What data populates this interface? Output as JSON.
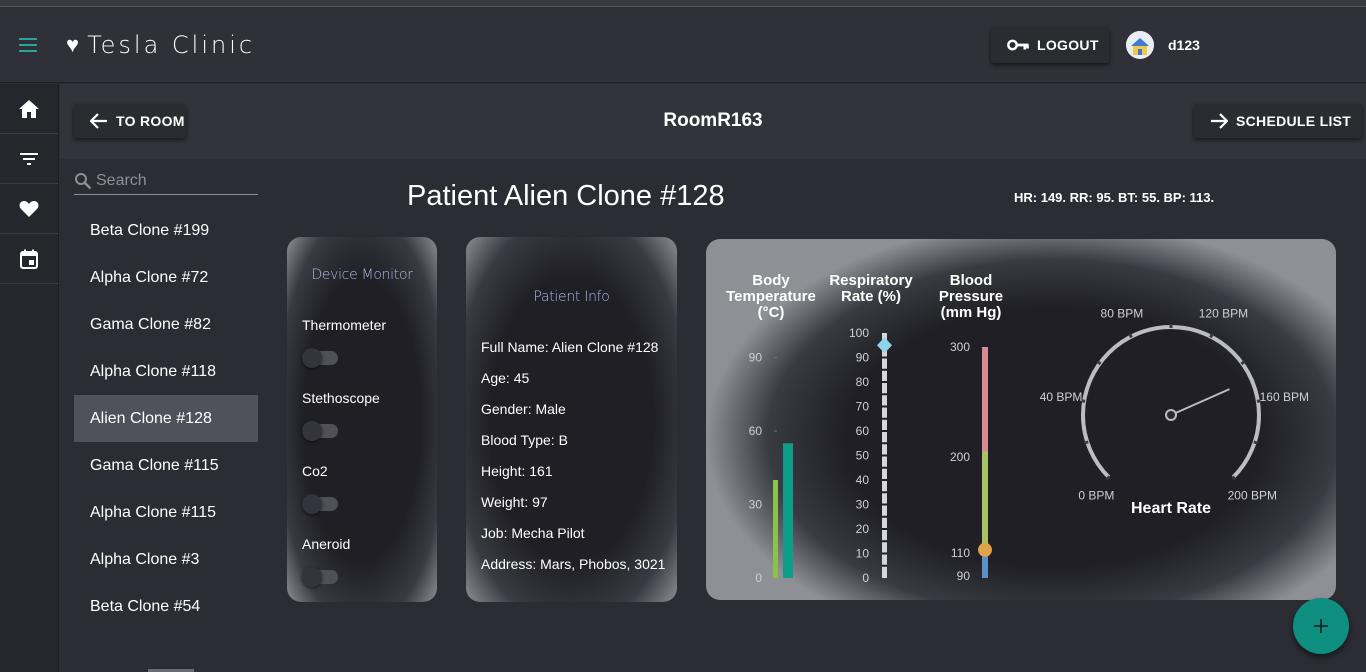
{
  "app": {
    "title": "Tesla Clinic",
    "user": "d123"
  },
  "header": {
    "logout_label": "LOGOUT"
  },
  "rail": {
    "items": [
      "home-icon",
      "filter-icon",
      "heart-icon",
      "calendar-icon"
    ]
  },
  "subbar": {
    "back_label": "TO ROOM",
    "room": "RoomR163",
    "schedule_label": "SCHEDULE LIST"
  },
  "search": {
    "placeholder": "Search",
    "value": ""
  },
  "patients": [
    "Beta Clone #199",
    "Alpha Clone #72",
    "Gama Clone #82",
    "Alpha Clone #118",
    "Alien Clone #128",
    "Gama Clone #115",
    "Alpha Clone #115",
    "Alpha Clone #3",
    "Beta Clone #54"
  ],
  "selected_patient": "Alien Clone #128",
  "patient": {
    "title": "Patient Alien Clone #128",
    "vitals_summary": "HR: 149. RR: 95. BT: 55. BP: 113."
  },
  "device_monitor": {
    "title": "Device Monitor",
    "devices": [
      {
        "label": "Thermometer",
        "on": false
      },
      {
        "label": "Stethoscope",
        "on": false
      },
      {
        "label": "Co2",
        "on": false
      },
      {
        "label": "Aneroid",
        "on": false
      }
    ]
  },
  "patient_info": {
    "title": "Patient Info",
    "lines": [
      "Full Name: Alien Clone #128",
      "Age: 45",
      "Gender: Male",
      "Blood Type: B",
      "Height: 161",
      "Weight: 97",
      "Job: Mecha Pilot",
      "Address: Mars, Phobos, 3021"
    ]
  },
  "gauges": {
    "body_temperature": {
      "label_lines": [
        "Body",
        "Temperature",
        "(°C)"
      ],
      "ticks": [
        "0",
        "30",
        "60",
        "90"
      ],
      "range": [
        0,
        100
      ],
      "bars": [
        {
          "value": 40,
          "color": "#8bc34a"
        },
        {
          "value": 55,
          "color": "#0e9e88"
        }
      ]
    },
    "respiratory_rate": {
      "label_lines": [
        "Respiratory",
        "Rate (%)"
      ],
      "ticks": [
        "0",
        "10",
        "20",
        "30",
        "40",
        "50",
        "60",
        "70",
        "80",
        "90",
        "100"
      ],
      "value": 95,
      "marker_color": "#8fd3e8"
    },
    "blood_pressure": {
      "label_lines": [
        "Blood",
        "Pressure",
        "(mm Hg)"
      ],
      "ticks": [
        "90",
        "110",
        "200",
        "300"
      ],
      "value": 113,
      "marker_color": "#e0a24a",
      "segments": [
        "#5b8fc8",
        "#a6c463",
        "#d98b95"
      ]
    },
    "heart_rate": {
      "label": "Heart Rate",
      "ticks": [
        "0 BPM",
        "40 BPM",
        "80 BPM",
        "120 BPM",
        "160 BPM",
        "200 BPM"
      ],
      "range": [
        0,
        200
      ],
      "value": 149
    }
  },
  "colors": {
    "accent": "#26a69a",
    "fab": "#0e8f80",
    "selected": "#50515b"
  }
}
